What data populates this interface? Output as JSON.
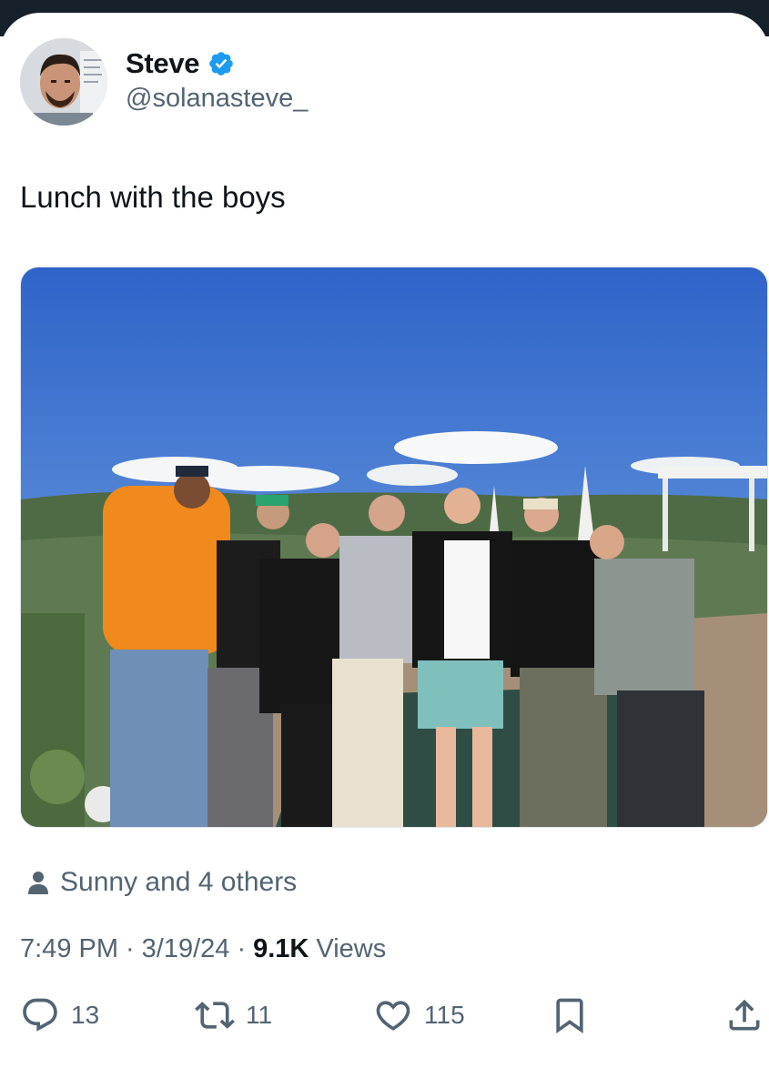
{
  "author": {
    "display_name": "Steve",
    "handle": "@solanasteve_",
    "verified": true
  },
  "tweet": {
    "text": "Lunch with the boys",
    "tagged": "Sunny and 4 others",
    "time": "7:49 PM",
    "separator": "·",
    "date": "3/19/24",
    "views_count": "9.1K",
    "views_label": "Views"
  },
  "actions": {
    "replies": "13",
    "retweets": "11",
    "likes": "115"
  },
  "colors": {
    "accent": "#1d9bf0",
    "secondary_text": "#536471",
    "primary_text": "#0f1419"
  }
}
